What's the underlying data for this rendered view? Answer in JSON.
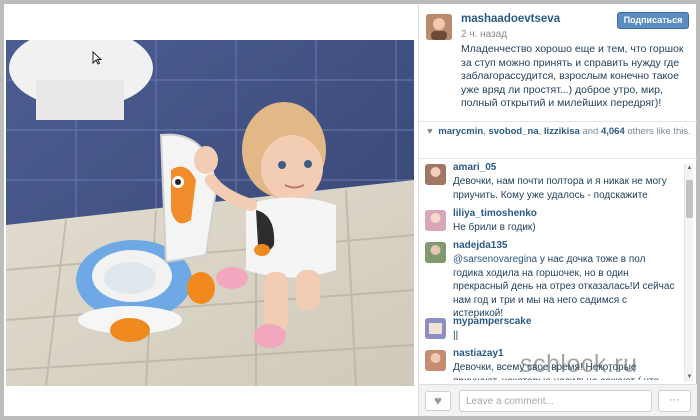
{
  "post": {
    "username": "mashaadoevtseva",
    "time": "2 ч. назад",
    "follow_label": "Подписаться",
    "caption": "Младенчество хорошо еще и тем, что горшок за ступ можно принять и справить нужду где заблагорассудится, взрослым конечно такое уже вряд ли простят...) доброе утро, мир, полный открытий и милейших передряг)!"
  },
  "likes": {
    "user1": "marycmin",
    "user2": "svobod_na",
    "user3": "lizzikisa",
    "and_label": "and",
    "count": "4,064",
    "tail": "others like this."
  },
  "comments": [
    {
      "user": "amari_05",
      "text": "Девочки, нам почти полтора и я никак не могу приучить. Кому уже удалось - подскажите"
    },
    {
      "user": "liliya_timoshenko",
      "text": "Не брили в годик)"
    },
    {
      "user": "nadejda135",
      "mention": "@sarsenovaregina",
      "text": " у нас дочка тоже в пол годика ходила на горшочек, но в один прекрасный день на отрез отказалась!И сейчас нам год и три и мы на него садимся с истерикой!"
    },
    {
      "user": "mypamperscake",
      "text": "||"
    },
    {
      "user": "nastiazay1",
      "text": "Девочки, всему свое время! Некоторые приучают, некоторые насильно сажают ( что еще"
    }
  ],
  "composer": {
    "placeholder": "Leave a comment...",
    "like_icon": "heart-icon",
    "more_label": "···"
  },
  "watermark": "schlock.ru",
  "colors": {
    "link": "#2a5a86",
    "follow_button": "#5b8dc2",
    "frame": "#bcbcbc"
  }
}
